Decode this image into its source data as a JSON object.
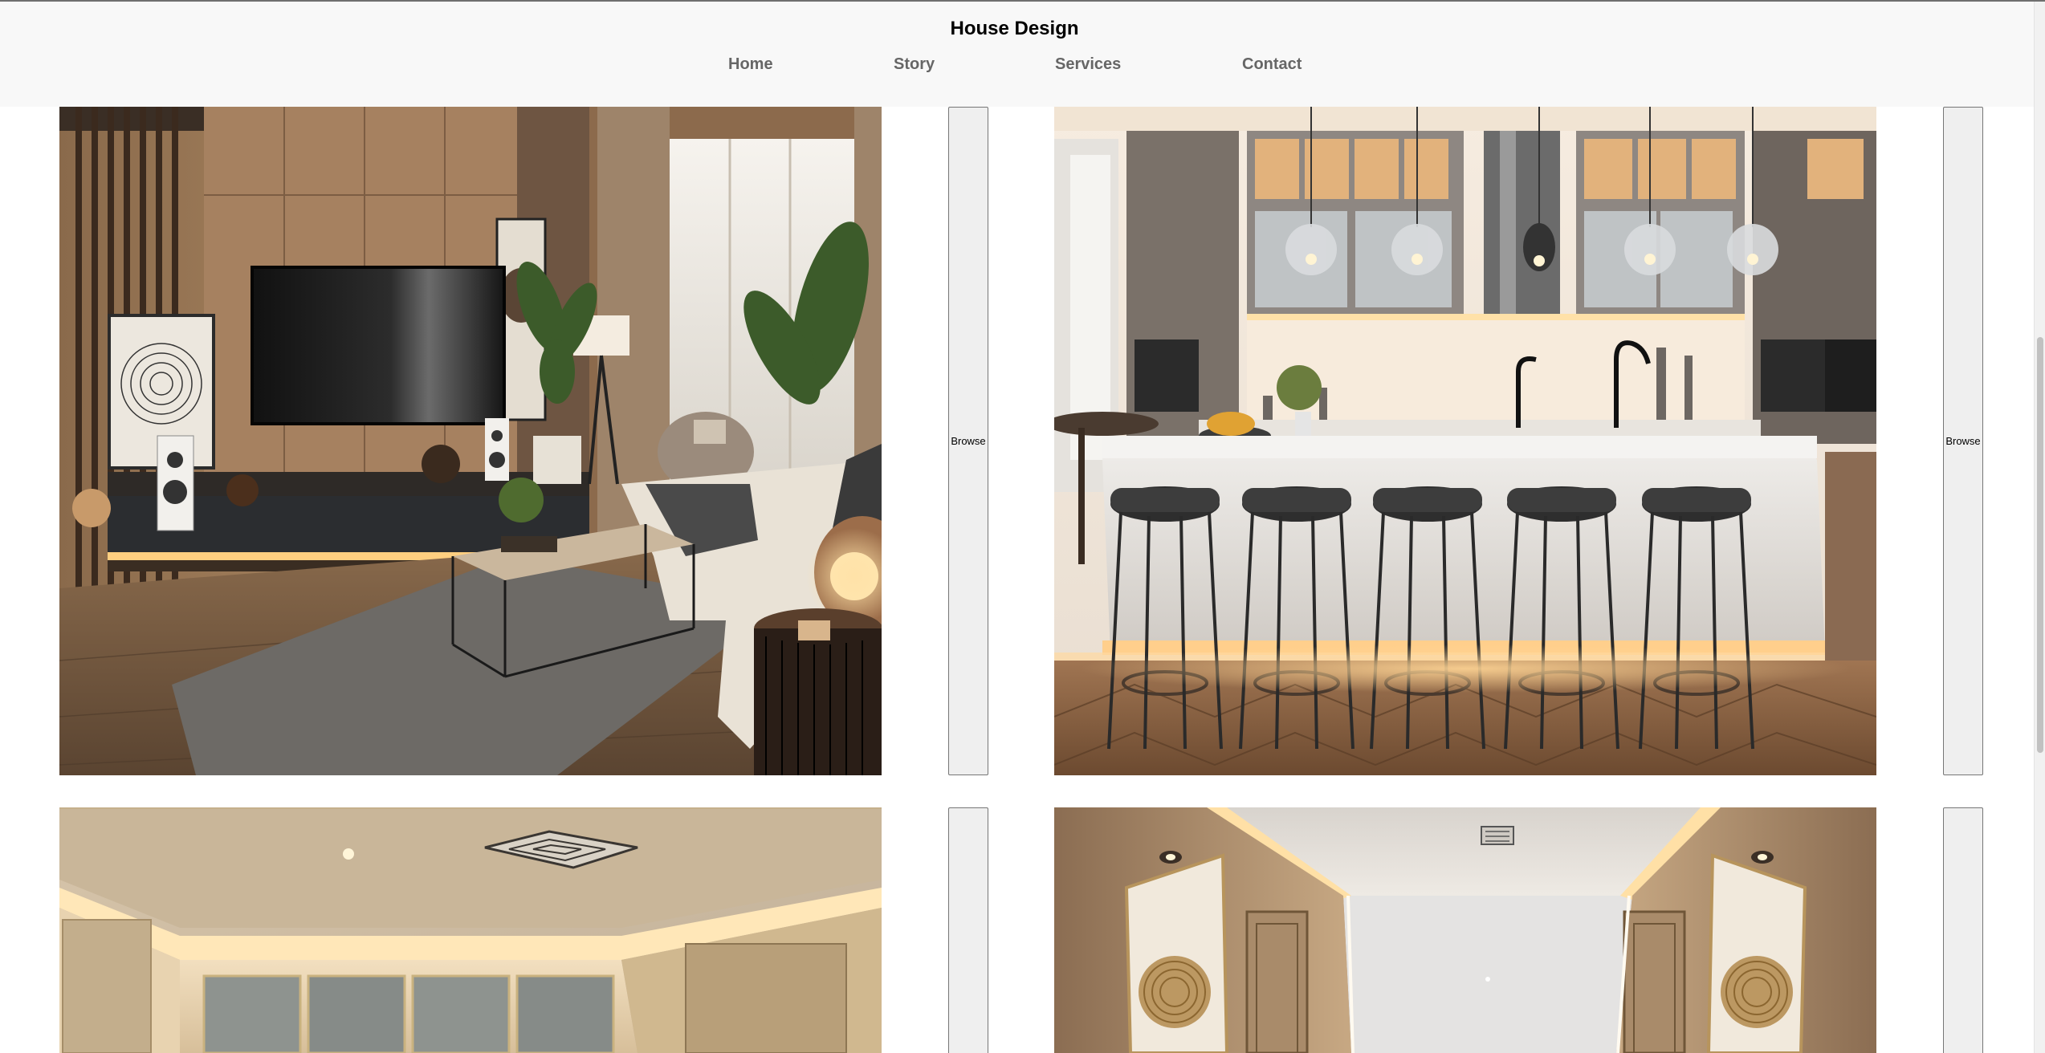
{
  "header": {
    "site_title": "House Design",
    "nav": [
      {
        "label": "Home"
      },
      {
        "label": "Story"
      },
      {
        "label": "Services"
      },
      {
        "label": "Contact"
      }
    ]
  },
  "gallery": {
    "browse_label": "Browse",
    "items": [
      {
        "image": "living-room-image"
      },
      {
        "image": "kitchen-image"
      },
      {
        "image": "ceiling-room-image"
      },
      {
        "image": "hallway-image"
      }
    ]
  },
  "colors": {
    "nav_background": "#f8f8f8",
    "nav_link": "#666666",
    "title": "#000000",
    "button_background": "#efefef"
  }
}
